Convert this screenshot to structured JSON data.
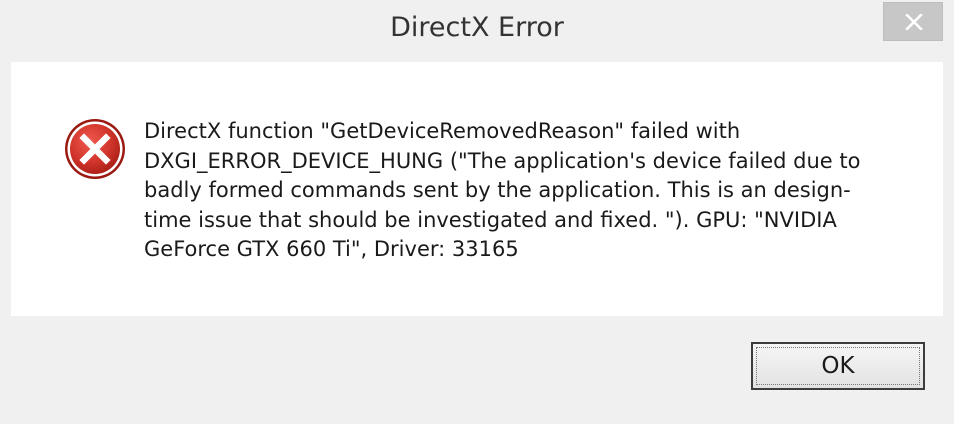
{
  "window": {
    "title": "DirectX Error",
    "close_icon": "close-icon"
  },
  "dialog": {
    "icon": "error-icon",
    "message": "DirectX function \"GetDeviceRemovedReason\" failed with DXGI_ERROR_DEVICE_HUNG (\"The application's device failed due to badly formed commands sent by the application. This is an design-time issue that should be investigated and fixed. \"). GPU: \"NVIDIA GeForce GTX 660 Ti\", Driver: 33165",
    "ok_label": "OK"
  },
  "colors": {
    "error_red": "#c42b1c",
    "window_bg": "#f0f0f0",
    "content_bg": "#ffffff"
  }
}
